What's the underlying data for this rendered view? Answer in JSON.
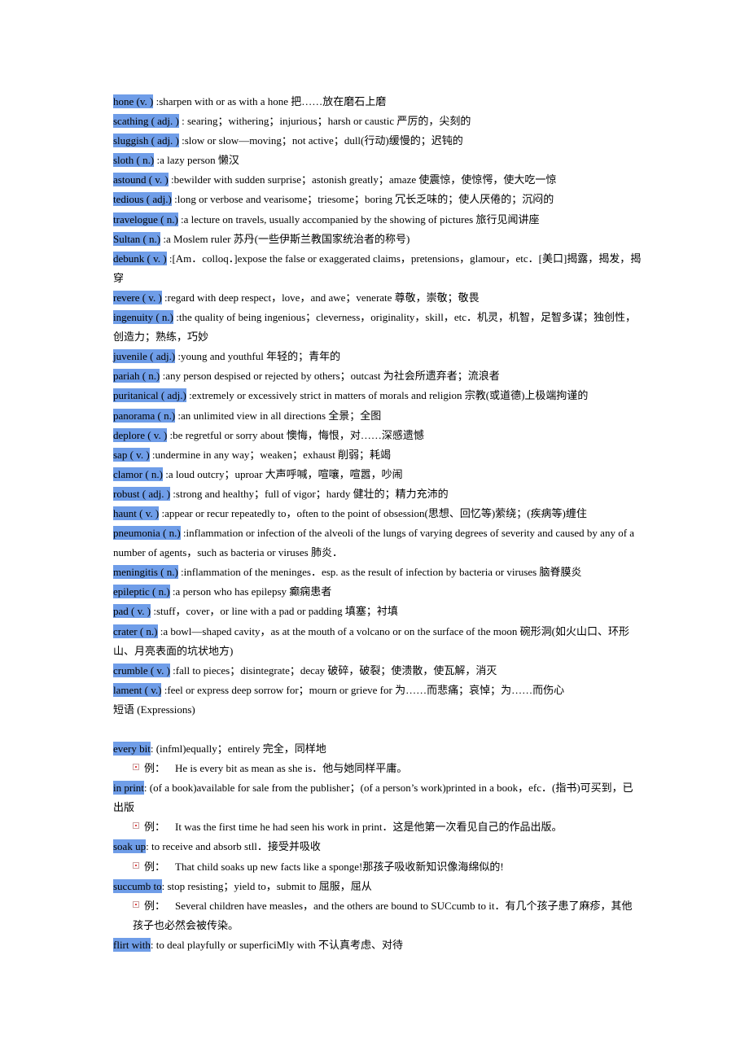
{
  "vocab": [
    {
      "term": "hone (v.  )",
      "def": " :sharpen with or as with a hone 把……放在磨石上磨"
    },
    {
      "term": "scathing ( adj. )",
      "def": " : searing；withering；injurious；harsh or caustic 严厉的，尖刻的"
    },
    {
      "term": "sluggish ( adj. )",
      "def": " :slow or slow—moving；not active；dull(行动)缓慢的；迟钝的"
    },
    {
      "term": "sloth ( n.)",
      "def": " :a lazy person 懒汉"
    },
    {
      "term": "astound ( v.  )",
      "def": " :bewilder with sudden surprise；astonish greatly；amaze 使震惊，使惊愕，使大吃一惊"
    },
    {
      "term": "tedious ( adj.)",
      "def": " :long or verbose and vearisome；triesome；boring 冗长乏味的；使人厌倦的；沉闷的"
    },
    {
      "term": "travelogue ( n.)",
      "def": " :a lecture on travels, usually accompanied by the showing of pictures 旅行见闻讲座"
    },
    {
      "term": "Sultan ( n.)",
      "def": " :a Moslem ruler 苏丹(一些伊斯兰教国家统治者的称号)"
    },
    {
      "term": "debunk ( v.  )",
      "def": " :[Am．colloq．]expose the false or exaggerated claims，pretensions，glamour，etc．[美口]揭露，揭发，揭穿"
    },
    {
      "term": "revere ( v.  )",
      "def": " :regard with deep respect，love，and awe；venerate 尊敬，崇敬；敬畏"
    },
    {
      "term": "ingenuity ( n.)",
      "def": " :the quality of being ingenious；cleverness，originality，skill，etc．机灵，机智，足智多谋；独创性，创造力；熟练，巧妙"
    },
    {
      "term": "juvenile ( adj.)",
      "def": " :young and youthful 年轻的；青年的"
    },
    {
      "term": "pariah ( n.)",
      "def": " :any person despised or rejected by others；outcast 为社会所遗弃者；流浪者"
    },
    {
      "term": "puritanical ( adj.)",
      "def": " :extremely or excessively strict in matters of morals and religion 宗教(或道德)上极端拘谨的"
    },
    {
      "term": "panorama ( n.)",
      "def": " :an unlimited view in all directions 全景；全图"
    },
    {
      "term": "deplore ( v.  )",
      "def": " :be regretful or sorry about 懊悔，悔恨，对……深感遗憾"
    },
    {
      "term": "sap ( v.  )",
      "def": " :undermine in any way；weaken；exhaust 削弱；耗竭"
    },
    {
      "term": "clamor ( n.)",
      "def": " :a loud outcry；uproar 大声呼喊，喧嚷，喧嚣，吵闹"
    },
    {
      "term": "robust ( adj. )",
      "def": " :strong and healthy；full of vigor；hardy 健壮的；精力充沛的"
    },
    {
      "term": "haunt ( v.  )",
      "def": " :appear or recur repeatedly to，often to the point of obsession(思想、回忆等)萦绕；(疾病等)缠住"
    },
    {
      "term": "pneumonia ( n.)",
      "def": " :inflammation or infection of the alveoli of the lungs of varying degrees of severity and caused by any of a number of agents，such as bacteria or viruses 肺炎．"
    },
    {
      "term": "meningitis ( n.)",
      "def": " :inflammation of the meninges．esp. as the result of infection by bacteria or viruses 脑脊膜炎"
    },
    {
      "term": "epileptic ( n.)",
      "def": " :a person who has epilepsy 癫痫患者"
    },
    {
      "term": "pad ( v.  )",
      "def": " :stuff，cover，or line with a pad or padding 填塞；衬填"
    },
    {
      "term": "crater ( n.)",
      "def": " :a bowl—shaped cavity，as at the mouth of a volcano or on the surface of the moon 碗形洞(如火山口、环形山、月亮表面的坑状地方)"
    },
    {
      "term": "crumble ( v.   )",
      "def": " :fall to pieces；disintegrate；decay 破碎，破裂；使溃散，使瓦解，消灭"
    },
    {
      "term": "lament ( v.)",
      "def": " :feel or express deep sorrow for；mourn or grieve for 为……而悲痛；哀悼；为……而伤心"
    }
  ],
  "expressions_heading": "短语  (Expressions)",
  "expressions": [
    {
      "term": "every bit",
      "def": ":   (infml)equally；entirely 完全，同样地",
      "example": "He is every bit as mean as she is．他与她同样平庸。"
    },
    {
      "term": "in print",
      "def": ":   (of a book)available for sale from the publisher；(of a person’s work)printed in a book，efc．(指书)可买到，已出版",
      "example": "It was the first time he had seen his work in print．这是他第一次看见自己的作品出版。"
    },
    {
      "term": "soak up",
      "def": ":   to receive and absorb stll．接受并吸收",
      "example": "That child soaks up new facts like a sponge!那孩子吸收新知识像海绵似的!"
    },
    {
      "term": "succumb to",
      "def": ":   stop resisting；yield to，submit to 屈服，屈从",
      "example": "Several children have measles，and the others are bound to SUCcumb to it．有几个孩子患了麻疹，其他孩子也必然会被传染。"
    },
    {
      "term": "flirt with",
      "def": ":   to deal playfully or superficiMly with 不认真考虑、对待",
      "example": null
    }
  ],
  "example_label": "例："
}
